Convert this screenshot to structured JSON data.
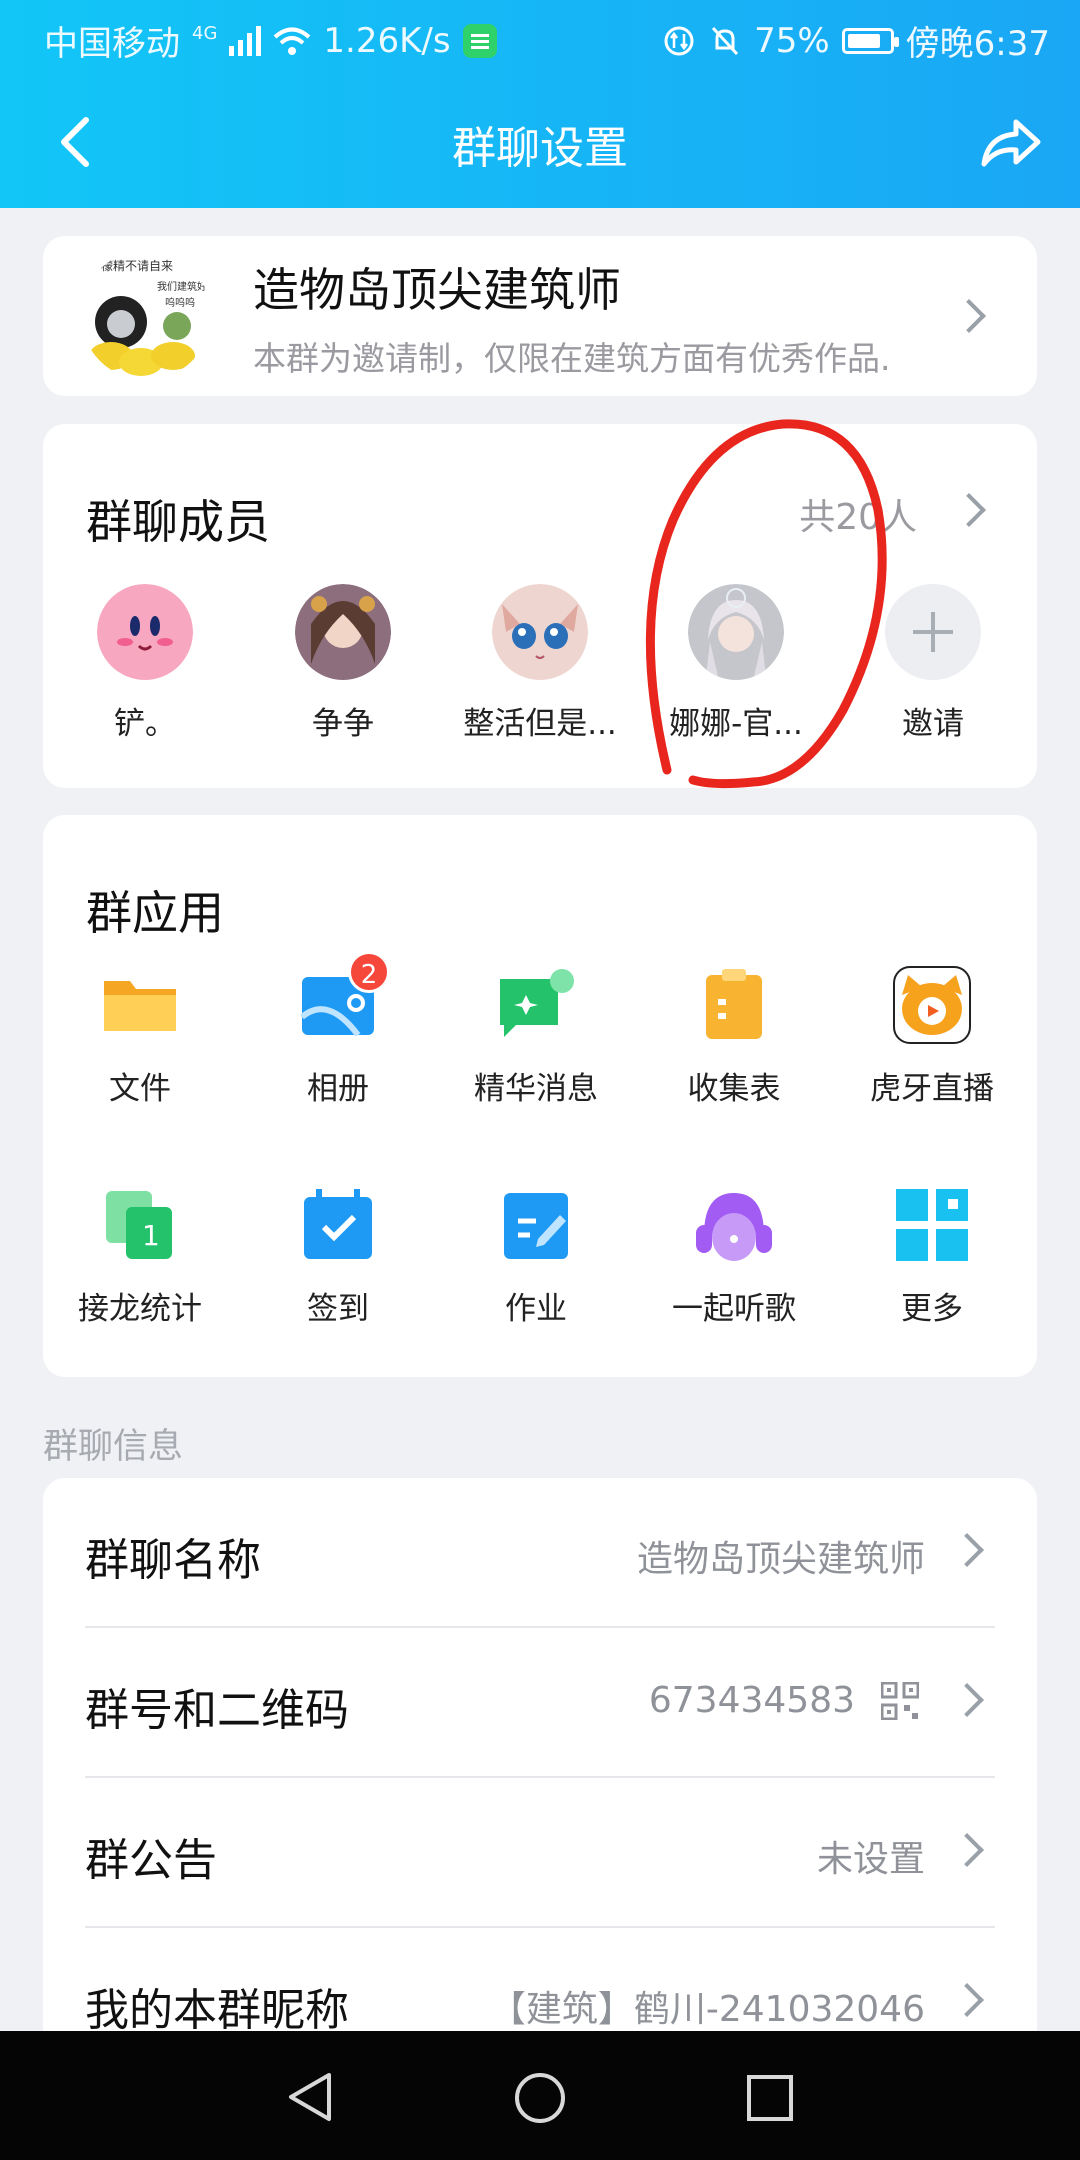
{
  "status_bar": {
    "carrier": "中国移动",
    "network": "4G",
    "speed": "1.26K/s",
    "battery": "75%",
    "time": "傍晚6:37"
  },
  "header": {
    "title": "群聊设置"
  },
  "group": {
    "name": "造物岛顶尖建筑师",
    "description": "本群为邀请制，仅限在建筑方面有优秀作品...",
    "avatar_text": "柠檬精不请自来 我们建筑好头 呜呜呜"
  },
  "members": {
    "title": "群聊成员",
    "count": "共20人",
    "items": [
      {
        "name": "铲。",
        "icon": "kirby-avatar"
      },
      {
        "name": "争争",
        "icon": "anime-girl-avatar"
      },
      {
        "name": "整活但是...",
        "icon": "cat-girl-avatar"
      },
      {
        "name": "娜娜-官...",
        "icon": "white-hair-girl-avatar"
      },
      {
        "name": "邀请",
        "icon": "plus-icon"
      }
    ]
  },
  "apps": {
    "title": "群应用",
    "items": [
      {
        "label": "文件",
        "icon": "folder-icon",
        "color": "#f8b431"
      },
      {
        "label": "相册",
        "icon": "album-icon",
        "color": "#1e9af5",
        "badge": "2"
      },
      {
        "label": "精华消息",
        "icon": "essence-message-icon",
        "color": "#23c26b"
      },
      {
        "label": "收集表",
        "icon": "clipboard-icon",
        "color": "#f8b431"
      },
      {
        "label": "虎牙直播",
        "icon": "huya-tiger-icon",
        "color": "#f7a21c"
      },
      {
        "label": "接龙统计",
        "icon": "solitaire-icon",
        "color": "#23c26b"
      },
      {
        "label": "签到",
        "icon": "calendar-check-icon",
        "color": "#1e9af5"
      },
      {
        "label": "作业",
        "icon": "homework-edit-icon",
        "color": "#1e9af5"
      },
      {
        "label": "一起听歌",
        "icon": "headphones-icon",
        "color": "#a35cf3"
      },
      {
        "label": "更多",
        "icon": "grid-more-icon",
        "color": "#18c1f0"
      }
    ]
  },
  "info": {
    "section_title": "群聊信息",
    "rows": [
      {
        "label": "群聊名称",
        "value": "造物岛顶尖建筑师"
      },
      {
        "label": "群号和二维码",
        "value": "673434583"
      },
      {
        "label": "群公告",
        "value": "未设置"
      },
      {
        "label": "我的本群昵称",
        "value": "【建筑】鹤川-241032046"
      }
    ]
  },
  "colors": {
    "header_start": "#12c6f7",
    "header_end": "#1aa7f5",
    "annotation_circle": "#e8261d"
  }
}
